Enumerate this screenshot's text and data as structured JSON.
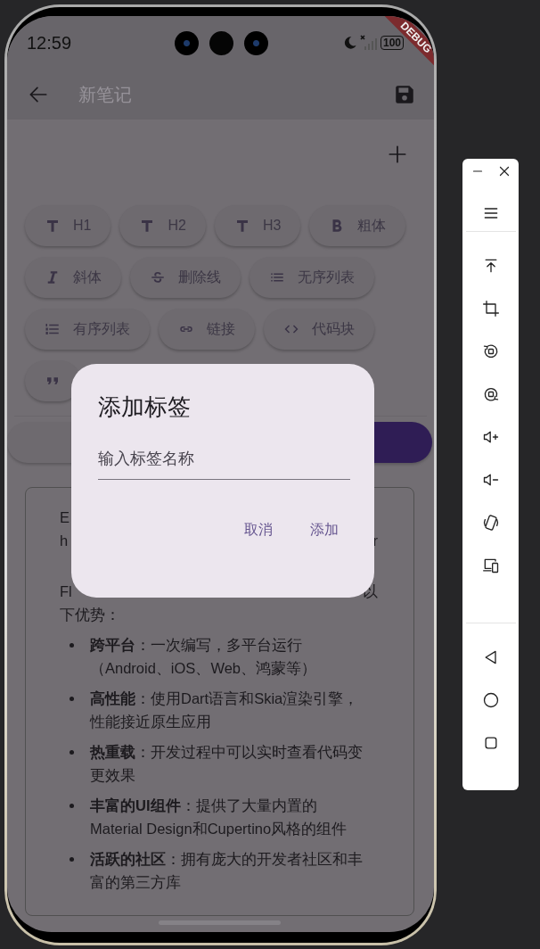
{
  "status_bar": {
    "time": "12:59",
    "battery": "100"
  },
  "debug_banner": "DEBUG",
  "app_bar": {
    "title": "新笔记"
  },
  "format_buttons": [
    {
      "kind": "h1",
      "label": "H1"
    },
    {
      "kind": "h2",
      "label": "H2"
    },
    {
      "kind": "h3",
      "label": "H3"
    },
    {
      "kind": "bold",
      "label": "粗体"
    },
    {
      "kind": "italic",
      "label": "斜体"
    },
    {
      "kind": "strike",
      "label": "删除线"
    },
    {
      "kind": "ul",
      "label": "无序列表"
    },
    {
      "kind": "ol",
      "label": "有序列表"
    },
    {
      "kind": "link",
      "label": "链接"
    },
    {
      "kind": "code",
      "label": "代码块"
    },
    {
      "kind": "quote"
    }
  ],
  "editor": {
    "paragraphs": [
      {
        "lines": [
          {
            "start": "E"
          },
          {
            "start": "h",
            "end": "r"
          },
          {
            "covered": true
          }
        ]
      },
      {
        "lines": [
          {
            "start": "Fl",
            "end": "以"
          },
          {
            "start": "下优势："
          }
        ]
      }
    ],
    "bullets": [
      {
        "text": "**跨平台**：一次编写，多平台运行（Android、iOS、Web、鸿蒙等）"
      },
      {
        "text": "**高性能**：使用Dart语言和Skia渲染引擎，性能接近原生应用"
      },
      {
        "text": "**热重载**：开发过程中可以实时查看代码变更效果"
      },
      {
        "text": "**丰富的UI组件**：提供了大量内置的Material Design和Cupertino风格的组件"
      },
      {
        "text": "**活跃的社区**：拥有庞大的开发者社区和丰富的第三方库"
      }
    ]
  },
  "dialog": {
    "title": "添加标签",
    "field": {
      "placeholder": "输入标签名称"
    },
    "buttons": [
      "取消",
      "添加"
    ]
  }
}
